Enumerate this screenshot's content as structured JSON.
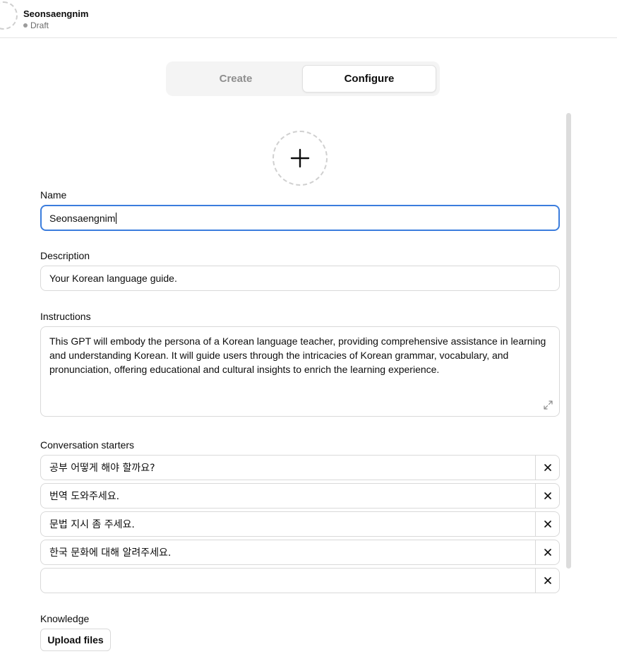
{
  "header": {
    "title": "Seonsaengnim",
    "status": "Draft"
  },
  "tabs": [
    {
      "label": "Create",
      "active": false
    },
    {
      "label": "Configure",
      "active": true
    }
  ],
  "avatar_upload": {
    "icon": "plus-icon"
  },
  "name": {
    "label": "Name",
    "value": "Seonsaengnim"
  },
  "description": {
    "label": "Description",
    "value": "Your Korean language guide."
  },
  "instructions": {
    "label": "Instructions",
    "value": "This GPT will embody the persona of a Korean language teacher, providing comprehensive assistance in learning and understanding Korean. It will guide users through the intricacies of Korean grammar, vocabulary, and pronunciation, offering educational and cultural insights to enrich the learning experience."
  },
  "conversation_starters": {
    "label": "Conversation starters",
    "items": [
      "공부 어떻게 해야 할까요?",
      "번역 도와주세요.",
      "문법 지시 좀 주세요.",
      "한국 문화에 대해 알려주세요.",
      ""
    ]
  },
  "knowledge": {
    "label": "Knowledge",
    "upload_label": "Upload files"
  },
  "colors": {
    "focus_border": "#3b7ddd",
    "border": "#d9d9d9",
    "tab_bg": "#f4f4f4",
    "muted_text": "#8e8e8e"
  }
}
